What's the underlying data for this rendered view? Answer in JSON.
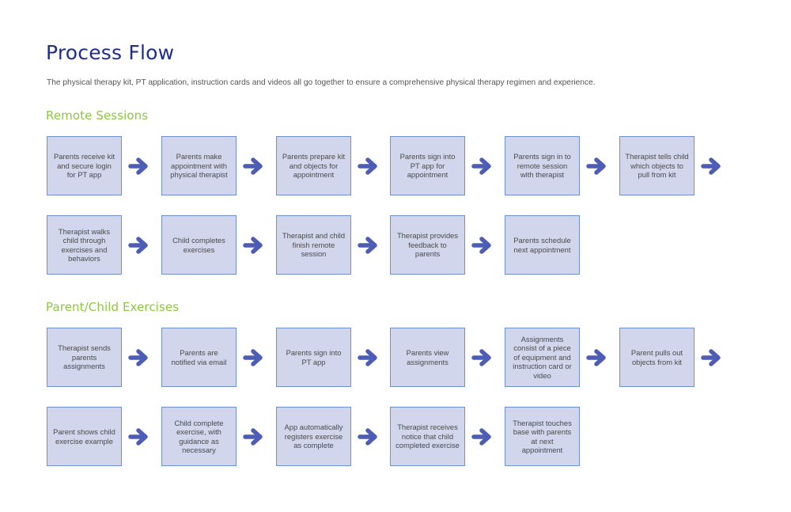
{
  "page": {
    "title": "Process Flow",
    "intro": "The physical therapy kit, PT application, instruction cards and videos all go together to ensure a comprehensive physical therapy regimen and experience."
  },
  "colors": {
    "title": "#1f2e8c",
    "section_title": "#8dc63f",
    "box_fill": "#d1d6ed",
    "box_border": "#6f8fd0",
    "arrow": "#4d5cb5"
  },
  "icons": {
    "connector": "arrow-right-icon"
  },
  "sections": [
    {
      "title": "Remote Sessions",
      "rows": [
        {
          "steps": [
            "Parents receive kit and secure login for PT app",
            "Parents make appointment with physical therapist",
            "Parents prepare kit and objects for appointment",
            "Parents sign into PT app for appointment",
            "Parents sign in to remote session with therapist",
            "Therapist tells child which objects to pull from kit"
          ],
          "trailing_arrow": true
        },
        {
          "steps": [
            "Therapist walks child through exercises and behaviors",
            "Child completes exercises",
            "Therapist and child finish remote session",
            "Therapist provides feedback to parents",
            "Parents schedule next appointment"
          ],
          "trailing_arrow": false
        }
      ]
    },
    {
      "title": "Parent/Child Exercises",
      "rows": [
        {
          "steps": [
            "Therapist sends parents assignments",
            "Parents are notified via email",
            "Parents sign into PT app",
            "Parents view assignments",
            "Assignments consist of a piece of equipment and instruction card or video",
            "Parent pulls out objects from kit"
          ],
          "trailing_arrow": true
        },
        {
          "steps": [
            "Parent shows child exercise example",
            "Child complete exercise, with guidance as necessary",
            "App automatically registers exercise as complete",
            "Therapist receives notice that child completed exercise",
            "Therapist touches base with parents at next appointment"
          ],
          "trailing_arrow": false
        }
      ]
    }
  ]
}
